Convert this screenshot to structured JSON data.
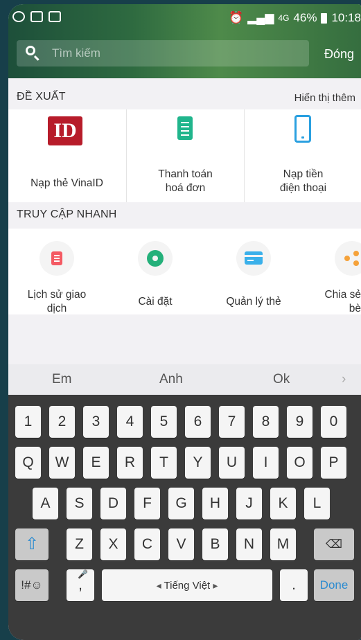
{
  "status_bar": {
    "network": "4G",
    "battery": "46%",
    "time": "10:18"
  },
  "search": {
    "placeholder": "Tìm kiếm",
    "close_label": "Đóng"
  },
  "suggestions": {
    "title": "ĐỀ XUẤT",
    "more_label": "Hiển thị thêm",
    "items": [
      {
        "label": "Nạp thẻ VinaID",
        "icon": "vinaid-logo-icon",
        "logo_text": "ID"
      },
      {
        "label": "Thanh toán\nhoá đơn",
        "icon": "bill-receipt-icon"
      },
      {
        "label": "Nạp tiền\nđiện thoại",
        "icon": "mobile-phone-icon"
      }
    ]
  },
  "quick_access": {
    "title": "TRUY CẬP NHANH",
    "items": [
      {
        "label": "Lịch sử giao\ndịch",
        "icon": "transaction-history-icon"
      },
      {
        "label": "Cài đặt",
        "icon": "settings-gear-icon"
      },
      {
        "label": "Quản lý thẻ",
        "icon": "card-icon"
      },
      {
        "label": "Chia sẻ\nbè",
        "icon": "share-icon"
      }
    ]
  },
  "keyboard": {
    "suggestions": [
      "Em",
      "Anh",
      "Ok"
    ],
    "more_icon": "chevron-right-icon",
    "number_row": [
      "1",
      "2",
      "3",
      "4",
      "5",
      "6",
      "7",
      "8",
      "9",
      "0"
    ],
    "row1": [
      "Q",
      "W",
      "E",
      "R",
      "T",
      "Y",
      "U",
      "I",
      "O",
      "P"
    ],
    "row2": [
      "A",
      "S",
      "D",
      "F",
      "G",
      "H",
      "J",
      "K",
      "L"
    ],
    "row3": [
      "Z",
      "X",
      "C",
      "V",
      "B",
      "N",
      "M"
    ],
    "symbols_label": "!#☺",
    "comma_label": ",",
    "space_label": "Tiếng Việt",
    "period_label": ".",
    "done_label": "Done"
  },
  "colors": {
    "header": "#2e6a40",
    "vinaid_red": "#b71c2a",
    "bill_green": "#20b58c",
    "phone_blue": "#2aa0e0",
    "history_red": "#f45a63",
    "settings_green": "#24b07a",
    "card_blue": "#3ab0ea",
    "share_orange": "#f5a23a",
    "keyboard_bg": "#3b3b3b",
    "done_blue": "#2c8bd0"
  }
}
